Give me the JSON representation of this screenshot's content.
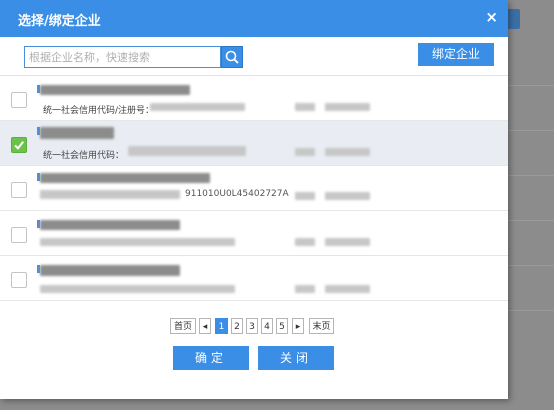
{
  "dialog": {
    "title": "选择/绑定企业",
    "close_icon": "×"
  },
  "search": {
    "placeholder": "根据企业名称，快速搜索",
    "value": "",
    "button_icon": "search-icon"
  },
  "bind_button": {
    "label": "绑定企业"
  },
  "rows": [
    {
      "label": "统一社会信用代码/注册号：",
      "code": "",
      "checked": false
    },
    {
      "label": "统一社会信用代码：",
      "code": "",
      "checked": true
    },
    {
      "label": "",
      "code": "911010U0L45402727A",
      "checked": false
    },
    {
      "label": "",
      "code": "",
      "checked": false
    },
    {
      "label": "",
      "code": "",
      "checked": false
    }
  ],
  "pagination": {
    "first": "首页",
    "prev": "◂",
    "pages": [
      "1",
      "2",
      "3",
      "4",
      "5"
    ],
    "current": "1",
    "next": "▸",
    "last": "末页"
  },
  "footer": {
    "confirm": "确定",
    "close": "关闭"
  },
  "colors": {
    "header": "#3a8ee6",
    "primary": "#3a8ee6",
    "checked": "#6dc24b",
    "selected_row": "#e9edf3",
    "overlay": "#8c8c8c"
  }
}
